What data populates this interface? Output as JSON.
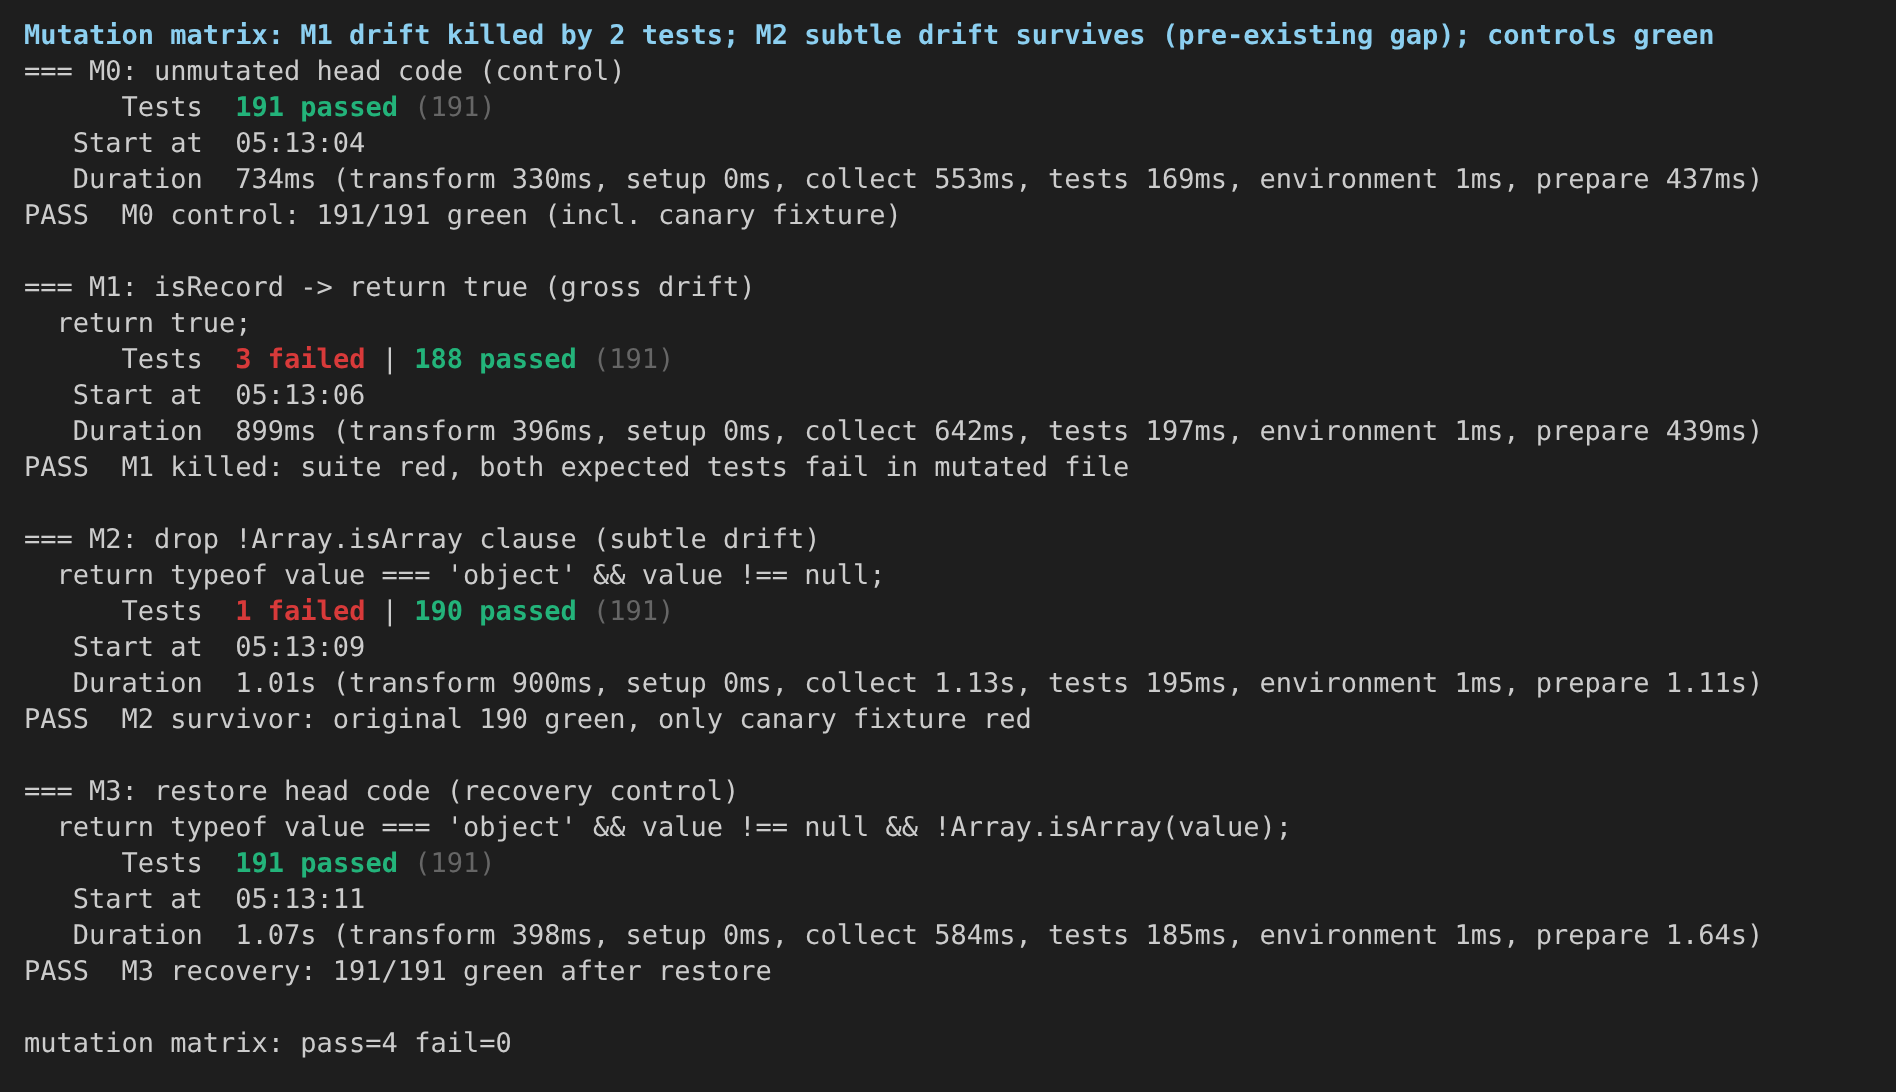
{
  "terminal": {
    "lines": [
      {
        "kind": "text",
        "segments": [
          {
            "text": "Mutation matrix: M1 drift killed by 2 tests; M2 subtle drift survives (pre-existing gap); controls green",
            "kind": "heading"
          }
        ]
      },
      {
        "kind": "text",
        "segments": [
          {
            "text": "=== M0: unmutated head code (control)",
            "kind": "plain"
          }
        ]
      },
      {
        "kind": "text",
        "segments": [
          {
            "text": "      Tests  ",
            "kind": "plain"
          },
          {
            "text": "191 passed",
            "kind": "pass"
          },
          {
            "text": " (191)",
            "kind": "dim"
          }
        ]
      },
      {
        "kind": "text",
        "segments": [
          {
            "text": "   Start at  05:13:04",
            "kind": "plain"
          }
        ]
      },
      {
        "kind": "text",
        "segments": [
          {
            "text": "   Duration  734ms (transform 330ms, setup 0ms, collect 553ms, tests 169ms, environment 1ms, prepare 437ms)",
            "kind": "plain"
          }
        ]
      },
      {
        "kind": "text",
        "segments": [
          {
            "text": "PASS  M0 control: 191/191 green (incl. canary fixture)",
            "kind": "plain"
          }
        ]
      },
      {
        "kind": "blank"
      },
      {
        "kind": "text",
        "segments": [
          {
            "text": "=== M1: isRecord -> return true (gross drift)",
            "kind": "plain"
          }
        ]
      },
      {
        "kind": "text",
        "segments": [
          {
            "text": "  return true;",
            "kind": "plain"
          }
        ]
      },
      {
        "kind": "text",
        "segments": [
          {
            "text": "      Tests  ",
            "kind": "plain"
          },
          {
            "text": "3 failed",
            "kind": "fail"
          },
          {
            "text": " | ",
            "kind": "plain"
          },
          {
            "text": "188 passed",
            "kind": "pass"
          },
          {
            "text": " (191)",
            "kind": "dim"
          }
        ]
      },
      {
        "kind": "text",
        "segments": [
          {
            "text": "   Start at  05:13:06",
            "kind": "plain"
          }
        ]
      },
      {
        "kind": "text",
        "segments": [
          {
            "text": "   Duration  899ms (transform 396ms, setup 0ms, collect 642ms, tests 197ms, environment 1ms, prepare 439ms)",
            "kind": "plain"
          }
        ]
      },
      {
        "kind": "text",
        "segments": [
          {
            "text": "PASS  M1 killed: suite red, both expected tests fail in mutated file",
            "kind": "plain"
          }
        ]
      },
      {
        "kind": "blank"
      },
      {
        "kind": "text",
        "segments": [
          {
            "text": "=== M2: drop !Array.isArray clause (subtle drift)",
            "kind": "plain"
          }
        ]
      },
      {
        "kind": "text",
        "segments": [
          {
            "text": "  return typeof value === 'object' && value !== null;",
            "kind": "plain"
          }
        ]
      },
      {
        "kind": "text",
        "segments": [
          {
            "text": "      Tests  ",
            "kind": "plain"
          },
          {
            "text": "1 failed",
            "kind": "fail"
          },
          {
            "text": " | ",
            "kind": "plain"
          },
          {
            "text": "190 passed",
            "kind": "pass"
          },
          {
            "text": " (191)",
            "kind": "dim"
          }
        ]
      },
      {
        "kind": "text",
        "segments": [
          {
            "text": "   Start at  05:13:09",
            "kind": "plain"
          }
        ]
      },
      {
        "kind": "text",
        "segments": [
          {
            "text": "   Duration  1.01s (transform 900ms, setup 0ms, collect 1.13s, tests 195ms, environment 1ms, prepare 1.11s)",
            "kind": "plain"
          }
        ]
      },
      {
        "kind": "text",
        "segments": [
          {
            "text": "PASS  M2 survivor: original 190 green, only canary fixture red",
            "kind": "plain"
          }
        ]
      },
      {
        "kind": "blank"
      },
      {
        "kind": "text",
        "segments": [
          {
            "text": "=== M3: restore head code (recovery control)",
            "kind": "plain"
          }
        ]
      },
      {
        "kind": "text",
        "segments": [
          {
            "text": "  return typeof value === 'object' && value !== null && !Array.isArray(value);",
            "kind": "plain"
          }
        ]
      },
      {
        "kind": "text",
        "segments": [
          {
            "text": "      Tests  ",
            "kind": "plain"
          },
          {
            "text": "191 passed",
            "kind": "pass"
          },
          {
            "text": " (191)",
            "kind": "dim"
          }
        ]
      },
      {
        "kind": "text",
        "segments": [
          {
            "text": "   Start at  05:13:11",
            "kind": "plain"
          }
        ]
      },
      {
        "kind": "text",
        "segments": [
          {
            "text": "   Duration  1.07s (transform 398ms, setup 0ms, collect 584ms, tests 185ms, environment 1ms, prepare 1.64s)",
            "kind": "plain"
          }
        ]
      },
      {
        "kind": "text",
        "segments": [
          {
            "text": "PASS  M3 recovery: 191/191 green after restore",
            "kind": "plain"
          }
        ]
      },
      {
        "kind": "blank"
      },
      {
        "kind": "text",
        "segments": [
          {
            "text": "mutation matrix: pass=4 fail=0",
            "kind": "plain"
          }
        ]
      }
    ]
  }
}
